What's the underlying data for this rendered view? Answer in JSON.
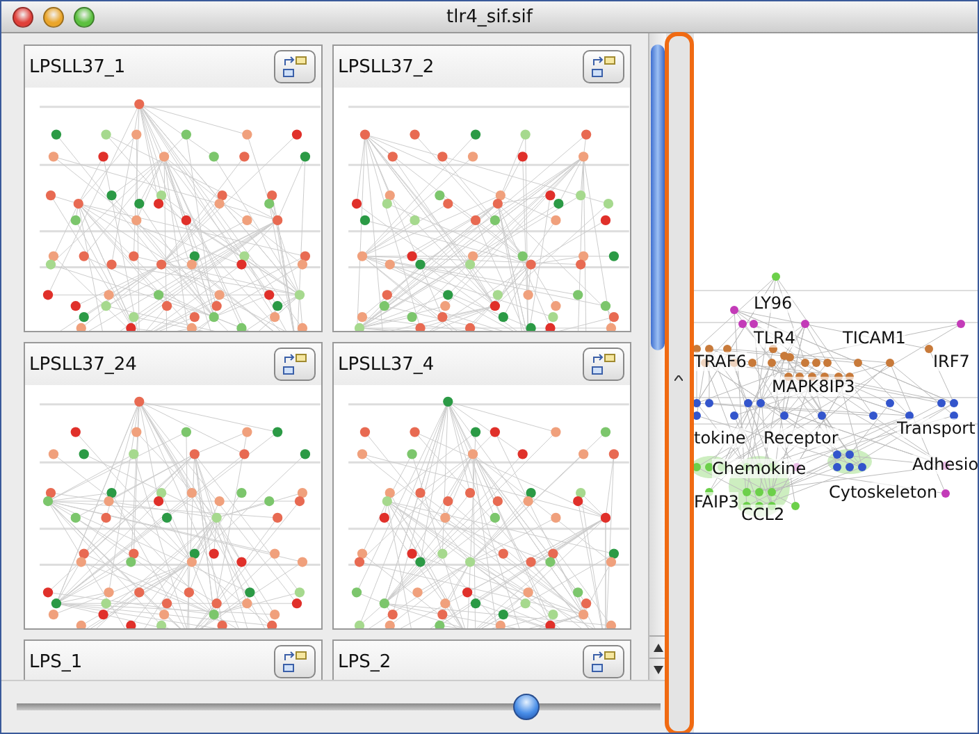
{
  "window": {
    "title": "tlr4_sif.sif"
  },
  "cards": [
    {
      "title": "LPSLL37_1"
    },
    {
      "title": "LPSLL37_2"
    },
    {
      "title": "LPSLL37_24"
    },
    {
      "title": "LPSLL37_4"
    },
    {
      "title": "LPS_1"
    },
    {
      "title": "LPS_2"
    }
  ],
  "zoom_slider": {
    "level": 0.79
  },
  "network": {
    "labels": [
      "LY96",
      "TLR4",
      "TICAM1",
      "TRAF6",
      "IRF7",
      "MAPK8IP3",
      "tokine",
      "Receptor",
      "Transport",
      "Chemokine",
      "Adhesio",
      "Cytoskeleton",
      "FAIP3",
      "CCL2"
    ]
  }
}
